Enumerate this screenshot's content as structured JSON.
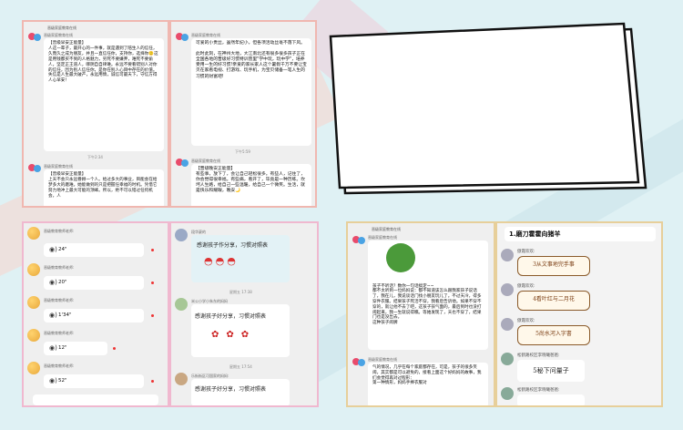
{
  "collage": {
    "background_color": "#dff1f4",
    "stripe_colors": [
      "#f7d7cf",
      "#d9ecef",
      "#cfe7ec"
    ]
  },
  "panel1": {
    "border_color": "#f0b7b0",
    "left": {
      "header": "晋级家庭教育在线",
      "sender1": "晋级家庭教育在线",
      "msg1": "【晋级早安正能量】\n人这一辈子，最开心的一件事，就是遇到了陪生人的信任，久而久之成为朋友，并且一直信任你，支持你，选择你🙂这是用钱都买不到的人格魅力，穷死不要嫌弃，难死不要偷人，坚定正王道人，哪阴自自律难。永远不要看错别人对你的信任，因为别人信任你，是你在别人心目中存在的价值。失信是人生最大破产，永远用情，诚信可最天下，守信方得人心早安！",
      "time": "下午2:34",
      "sender2": "晋级家庭教育在线",
      "msg2": "【晋级早安正能量】\n上天不会只永远眷顾一个人。给过多大的事业，目能会在给梦多大的磨难。她能做到的只是把握任幸福的时机。凭借它努力地冲上最大可能的顶峰。所以，绝不可以错过任何机会，人"
    },
    "right": {
      "sender1": "晋级家庭教育在线",
      "msg1": "可爱的小贵丝，虽然年纪小，但各项活动丝毫不落下风。\n\n此时此刻，在神州大地，大江南北还有很多很多孩子正在全国各地的晋级好习惯特训营里\"学中玩，玩中学\"，培养受用一生的好习惯!亲爱的家长家人这个暑假千万不要让宝贝在家看电视、打游戏、玩手机，为宝贝储备一笔人生的习惯的财富吧!",
      "time": "下午5:59",
      "sender2": "晋级家庭教育在线",
      "msg2": "【晋级晚安正能量】\n有些事，放下了，会让自己轻松很多。有些人，记住了，你会觉得很幸福。有些痛，看开了，毕竟是一种历练。坎坷人生路，给自己一些温暖，给自己一个微笑。生活，就是快乐和耀眼，晚安🌙"
    }
  },
  "popup": {
    "title": "",
    "border_color": "#111111"
  },
  "panel2": {
    "border_color": "#f0b8cf",
    "left": {
      "sender": "晋级教育教师老师:",
      "voices": [
        "24\"",
        "20\"",
        "1'34\"",
        "12\"",
        "52\""
      ]
    },
    "right": {
      "sender1": "段华豪的",
      "hw1": "感谢孩子作分享，习惯对照表",
      "time1": "星期五 17:38",
      "sender2": "米公小学小朱东的妈妈",
      "hw2": "感谢孩子好分享，习惯对照表",
      "time2": "星期五 17:54",
      "sender3": "乐街街区可国家的妈妈:",
      "hw3": "感谢孩子好分享，习惯对照表"
    }
  },
  "panel3": {
    "border_color": "#e7cf9a",
    "left": {
      "header": "晋级家庭教育在线",
      "sender1": "晋级家庭教育在线",
      "msg1": "孩子不听话？数你一句话搞定~~\n都不太听到一位妈妈说：都不知道该怎么跟我家孩子说话了，我在儿，我说谈话门找小朋友玩儿了。不过天冷，得多穿件衣服。结果孩子死活不穿，我看后告诉他。如果不穿不穿的，就让他不去了吧，这孩子孩气面的，最后到时也没打闹起来，我一生就说得瞧。等她发现了，天也不穿了，结果门也是没出去。\n这种孩子闹脾",
      "sender2": "晋级家庭教育在线",
      "msg2": "气的情况，几乎在每个家庭都存在，可是，孩子的很多笑闹，其实都是可以避免的，接看上面这个好妈妈的故事，我们会觉得再对过程形：\n第一种情形，妈妈手捧衣服对"
    },
    "right": {
      "title": "1.磨刀霍霍向猪羊",
      "sender1": "傲霞欢欢:",
      "scroll1": "3从文事地完手事",
      "sender2": "傲霞欢欢:",
      "scroll2": "4看叶红与二月花",
      "sender3": "傲霞欢欢:",
      "scroll3": "5尚水河入字書",
      "sender4": "松鹤路校区李晓曦爸爸:",
      "hw4": "5秘下问量子",
      "sender5": "松鹤路校区李晓曦爸爸:"
    }
  }
}
